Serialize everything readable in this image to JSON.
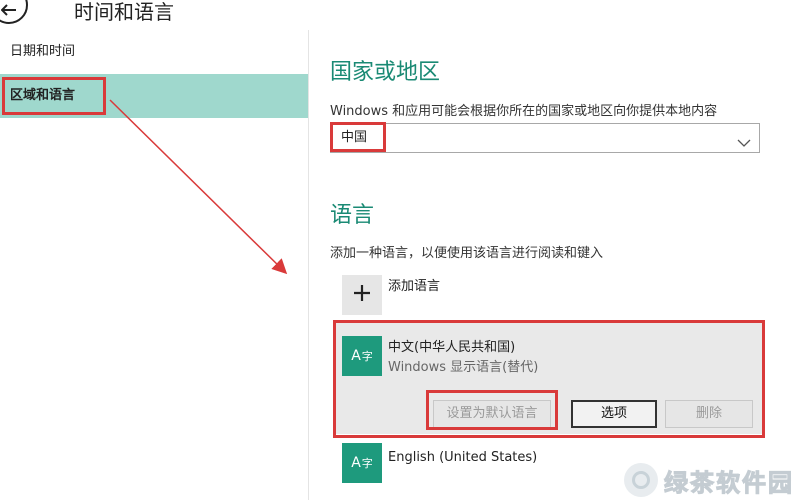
{
  "header": {
    "title": "时间和语言"
  },
  "sidebar": {
    "items": [
      {
        "label": "日期和时间"
      },
      {
        "label": "区域和语言"
      }
    ]
  },
  "region": {
    "title": "国家或地区",
    "description": "Windows 和应用可能会根据你所在的国家或地区向你提供本地内容",
    "selected_country": "中国"
  },
  "language": {
    "title": "语言",
    "description": "添加一种语言，以便使用该语言进行阅读和键入",
    "add_label": "添加语言",
    "languages": [
      {
        "icon_glyph": "A",
        "icon_sup": "字",
        "name": "中文(中华人民共和国)",
        "subtitle": "Windows 显示语言(替代)",
        "buttons": {
          "set_default": "设置为默认语言",
          "options": "选项",
          "remove": "删除"
        }
      },
      {
        "icon_glyph": "A",
        "icon_sup": "字",
        "name": "English (United States)"
      }
    ]
  },
  "watermark": {
    "text": "绿茶软件园"
  },
  "colors": {
    "accent": "#1e9a7d",
    "selected_sidebar": "#9fd8cd",
    "highlight_red": "#d93a3a"
  },
  "icons": [
    "back-arrow-icon",
    "plus-icon",
    "chevron-down-icon",
    "language-icon"
  ]
}
